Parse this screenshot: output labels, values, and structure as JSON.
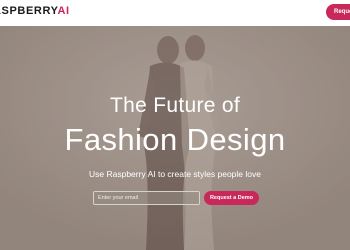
{
  "header": {
    "logo_main": "ASPBERRY",
    "logo_accent": "AI",
    "cta_label": "Request a"
  },
  "hero": {
    "headline_line1": "The Future of",
    "headline_line2": "Fashion Design",
    "subheadline": "Use Raspberry AI to create styles people love",
    "email_placeholder": "Enter your email",
    "cta_label": "Request a Demo"
  },
  "colors": {
    "accent": "#c8285a",
    "hero_background": "#a99c92",
    "text_on_hero": "#ffffff"
  }
}
